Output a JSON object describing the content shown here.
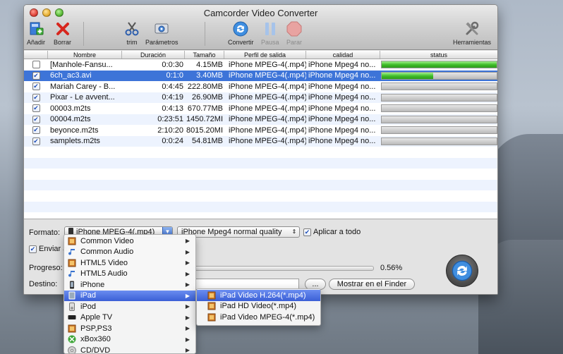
{
  "window": {
    "title": "Camcorder Video Converter"
  },
  "toolbar": {
    "add": "Añadir",
    "delete": "Borrar",
    "trim": "trim",
    "params": "Parámetros",
    "convert": "Convertir",
    "pause": "Pausa",
    "stop": "Parar",
    "tools": "Herramientas"
  },
  "table": {
    "headers": {
      "name": "Nombre",
      "duration": "Duración",
      "size": "Tamaño",
      "profile": "Perfil de salida",
      "quality": "calidad",
      "status": "status"
    },
    "rows": [
      {
        "checked": false,
        "name": "[Manhole-Fansu...",
        "duration": "0:0:30",
        "size": "4.15MB",
        "profile": "iPhone MPEG-4(.mp4)",
        "quality": "iPhone Mpeg4 no...",
        "progress": 1.0,
        "selected": false
      },
      {
        "checked": true,
        "name": "6ch_ac3.avi",
        "duration": "0:1:0",
        "size": "3.40MB",
        "profile": "iPhone MPEG-4(.mp4)",
        "quality": "iPhone Mpeg4 no...",
        "progress": 0.45,
        "selected": true
      },
      {
        "checked": true,
        "name": "Mariah Carey - B...",
        "duration": "0:4:45",
        "size": "222.80MB",
        "profile": "iPhone MPEG-4(.mp4)",
        "quality": "iPhone Mpeg4 no...",
        "progress": 0,
        "selected": false
      },
      {
        "checked": true,
        "name": "Pixar - Le avvent...",
        "duration": "0:4:19",
        "size": "26.90MB",
        "profile": "iPhone MPEG-4(.mp4)",
        "quality": "iPhone Mpeg4 no...",
        "progress": 0,
        "selected": false
      },
      {
        "checked": true,
        "name": "00003.m2ts",
        "duration": "0:4:13",
        "size": "670.77MB",
        "profile": "iPhone MPEG-4(.mp4)",
        "quality": "iPhone Mpeg4 no...",
        "progress": 0,
        "selected": false
      },
      {
        "checked": true,
        "name": "00004.m2ts",
        "duration": "0:23:51",
        "size": "1450.72MI",
        "profile": "iPhone MPEG-4(.mp4)",
        "quality": "iPhone Mpeg4 no...",
        "progress": 0,
        "selected": false
      },
      {
        "checked": true,
        "name": "beyonce.m2ts",
        "duration": "2:10:20",
        "size": "8015.20MI",
        "profile": "iPhone MPEG-4(.mp4)",
        "quality": "iPhone Mpeg4 no...",
        "progress": 0,
        "selected": false
      },
      {
        "checked": true,
        "name": "samplets.m2ts",
        "duration": "0:0:24",
        "size": "54.81MB",
        "profile": "iPhone MPEG-4(.mp4)",
        "quality": "iPhone Mpeg4 no...",
        "progress": 0,
        "selected": false
      }
    ]
  },
  "bottom": {
    "format_label": "Formato:",
    "format_value": "iPhone MPEG-4(.mp4)",
    "quality_value": "iPhone Mpeg4 normal quality",
    "apply_all": "Aplicar a todo",
    "send_label": "Enviar a",
    "progress_label": "Progreso:",
    "progress_value": "0.56%",
    "progress_fraction": 0.0056,
    "dest_label": "Destino:",
    "browse": "...",
    "show_finder": "Mostrar en el Finder"
  },
  "menu": {
    "items": [
      {
        "label": "Common Video",
        "icon": "film-icon"
      },
      {
        "label": "Common Audio",
        "icon": "music-note-icon"
      },
      {
        "label": "HTML5 Video",
        "icon": "film-icon"
      },
      {
        "label": "HTML5 Audio",
        "icon": "music-note-icon"
      },
      {
        "label": "iPhone",
        "icon": "phone-icon"
      },
      {
        "label": "iPad",
        "icon": "tablet-icon"
      },
      {
        "label": "iPod",
        "icon": "ipod-icon"
      },
      {
        "label": "Apple TV",
        "icon": "apple-tv-icon"
      },
      {
        "label": "PSP,PS3",
        "icon": "film-icon"
      },
      {
        "label": "xBox360",
        "icon": "xbox-icon"
      },
      {
        "label": "CD/DVD",
        "icon": "disc-icon"
      }
    ],
    "highlighted_index": 5,
    "submenu": [
      "iPad Video H.264(*.mp4)",
      "iPad HD Video(*.mp4)",
      "iPad Video MPEG-4(*.mp4)"
    ],
    "submenu_highlighted_index": 0
  },
  "colors": {
    "selection": "#3d74d8",
    "progress_green": "#3dbb27",
    "menu_highlight": "#3a5fd6"
  }
}
